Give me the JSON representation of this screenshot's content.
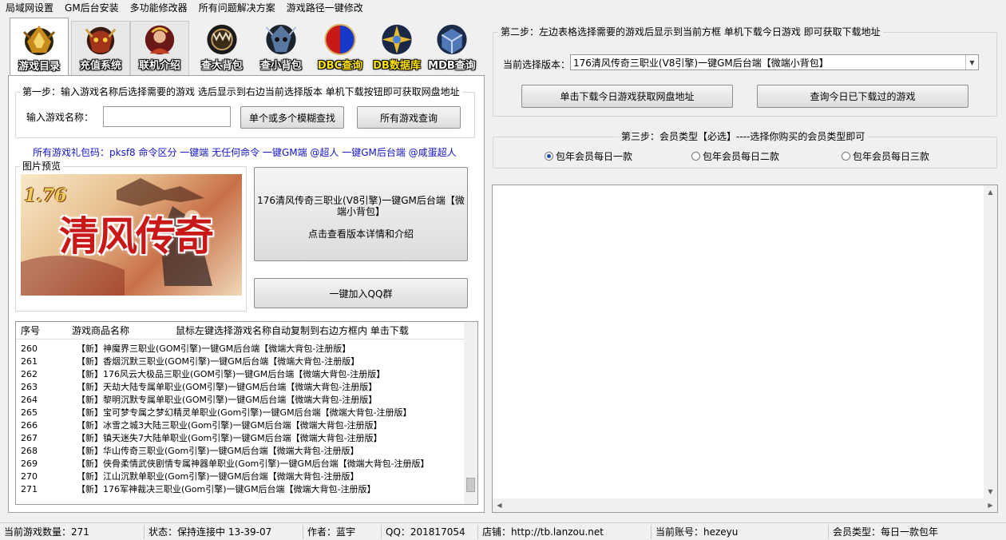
{
  "menu": [
    "局域网设置",
    "GM后台安装",
    "多功能修改器",
    "所有问题解决方案",
    "游戏路径一键修改"
  ],
  "tabs": [
    {
      "label": "游戏目录",
      "icon": "dragon-helm-icon",
      "yellow": false
    },
    {
      "label": "充值系统",
      "icon": "demon-mask-icon",
      "yellow": false
    },
    {
      "label": "联机介绍",
      "icon": "warrior-avatar-icon",
      "yellow": false
    },
    {
      "label": "查大背包",
      "icon": "fang-circle-icon",
      "yellow": false
    },
    {
      "label": "查小背包",
      "icon": "crystal-skull-icon",
      "yellow": false
    },
    {
      "label": "DBC查询",
      "icon": "red-blue-orb-icon",
      "yellow": true
    },
    {
      "label": "DB数据库",
      "icon": "golden-cross-icon",
      "yellow": true
    },
    {
      "label": "MDB查询",
      "icon": "blue-box-icon",
      "yellow": false
    }
  ],
  "step1": {
    "title": "第一步：输入游戏名称后选择需要的游戏 选后显示到右边当前选择版本  单机下载按钮即可获取网盘地址",
    "name_label": "输入游戏名称：",
    "name_value": "",
    "fuzzy_button": "单个或多个模糊查找",
    "all_button": "所有游戏查询"
  },
  "gift_code": "所有游戏礼包码：pksf8 命令区分 一键端 无任何命令 一键GM端 @超人 一键GM后台端 @咸蛋超人",
  "preview": {
    "title": "图片预览",
    "image_text": "清风传奇",
    "image_version": "1.76",
    "game_name": "176清风传奇三职业(V8引擎)一键GM后台端【微端小背包】",
    "detail_link": "点击查看版本详情和介绍",
    "qq_button": "一键加入QQ群"
  },
  "list": {
    "headers": [
      "序号",
      "游戏商品名称",
      "鼠标左键选择游戏名称自动复制到右边方框内 单击下载"
    ],
    "rows": [
      {
        "id": "260",
        "name": "【新】神魔界三职业(GOM引擎)一键GM后台端【微端大背包-注册版】"
      },
      {
        "id": "261",
        "name": "【新】香烟沉默三职业(GOM引擎)一键GM后台端【微端大背包-注册版】"
      },
      {
        "id": "262",
        "name": "【新】176风云大极品三职业(GOM引擎)一键GM后台端【微端大背包-注册版】"
      },
      {
        "id": "263",
        "name": "【新】天劫大陆专属单职业(GOM引擎)一键GM后台端【微端大背包-注册版】"
      },
      {
        "id": "264",
        "name": "【新】黎明沉默专属单职业(GOM引擎)一键GM后台端【微端大背包-注册版】"
      },
      {
        "id": "265",
        "name": "【新】宝可梦专属之梦幻精灵单职业(Gom引擎)一键GM后台端【微端大背包-注册版】"
      },
      {
        "id": "266",
        "name": "【新】冰雪之城3大陆三职业(Gom引擎)一键GM后台端【微端大背包-注册版】"
      },
      {
        "id": "267",
        "name": "【新】镇天迷失7大陆单职业(Gom引擎)一键GM后台端【微端大背包-注册版】"
      },
      {
        "id": "268",
        "name": "【新】华山传奇三职业(Gom引擎)一键GM后台端【微端大背包-注册版】"
      },
      {
        "id": "269",
        "name": "【新】侠骨柔情武侠剧情专属神器单职业(Gom引擎)一键GM后台端【微端大背包-注册版】"
      },
      {
        "id": "270",
        "name": "【新】江山沉默单职业(Gom引擎)一键GM后台端【微端大背包-注册版】"
      },
      {
        "id": "271",
        "name": "【新】176军神裁决三职业(Gom引擎)一键GM后台端【微端大背包-注册版】"
      }
    ]
  },
  "step2": {
    "title": "第二步：左边表格选择需要的游戏后显示到当前方框 单机下载今日游戏 即可获取下载地址",
    "version_label": "当前选择版本：",
    "version_value": "176清风传奇三职业(V8引擎)一键GM后台端【微端小背包】",
    "download_button": "单击下载今日游戏获取网盘地址",
    "history_button": "查询今日已下载过的游戏"
  },
  "step3": {
    "title": "第三步：会员类型【必选】----选择你购买的会员类型即可",
    "options": [
      "包年会员每日一款",
      "包年会员每日二款",
      "包年会员每日三款"
    ],
    "selected": 0
  },
  "status": {
    "count": "当前游戏数量：271",
    "state": "状态：保持连接中 13-39-07",
    "author": "作者：蓝宇",
    "qq": "QQ：201817054",
    "shop": "店铺：http://tb.lanzou.net",
    "account": "当前账号：hezeyu",
    "member": "会员类型：每日一款包年"
  }
}
